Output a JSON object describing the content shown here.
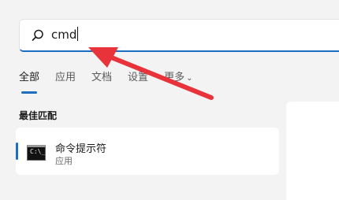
{
  "search": {
    "query": "cmd"
  },
  "tabs": [
    {
      "label": "全部"
    },
    {
      "label": "应用"
    },
    {
      "label": "文档"
    },
    {
      "label": "设置"
    },
    {
      "label": "更多"
    }
  ],
  "section_title": "最佳匹配",
  "best_match": {
    "name": "命令提示符",
    "type": "应用"
  },
  "colors": {
    "accent": "#1a6fc2",
    "arrow": "#e8333a"
  },
  "icons": [
    "search-icon",
    "chevron-down-icon",
    "command-prompt-icon"
  ]
}
